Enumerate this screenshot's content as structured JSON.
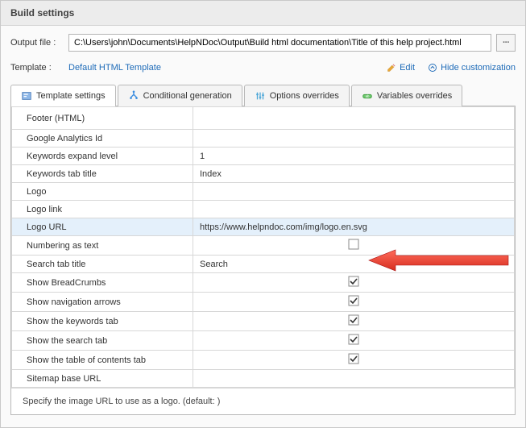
{
  "header": {
    "title": "Build settings"
  },
  "file": {
    "label": "Output file :",
    "value": "C:\\Users\\john\\Documents\\HelpNDoc\\Output\\Build html documentation\\Title of this help project.html"
  },
  "template": {
    "label": "Template :",
    "link": "Default HTML Template",
    "edit": "Edit",
    "hide": "Hide customization"
  },
  "tabs": [
    {
      "label": "Template settings"
    },
    {
      "label": "Conditional generation"
    },
    {
      "label": "Options overrides"
    },
    {
      "label": "Variables overrides"
    }
  ],
  "rows": {
    "footer": "Footer (HTML)",
    "ga": "Google Analytics Id",
    "kwExpand": "Keywords expand level",
    "kwExpandVal": "1",
    "kwTab": "Keywords tab title",
    "kwTabVal": "Index",
    "logo": "Logo",
    "logoLink": "Logo link",
    "logoUrl": "Logo URL",
    "logoUrlVal": "https://www.helpndoc.com/img/logo.en.svg",
    "numbering": "Numbering as text",
    "searchTab": "Search tab title",
    "searchTabVal": "Search",
    "bread": "Show BreadCrumbs",
    "nav": "Show navigation arrows",
    "showKw": "Show the keywords tab",
    "showSearch": "Show the search tab",
    "showToc": "Show the table of contents tab",
    "sitemap": "Sitemap base URL"
  },
  "description": "Specify the image URL to use as a logo. (default: )"
}
